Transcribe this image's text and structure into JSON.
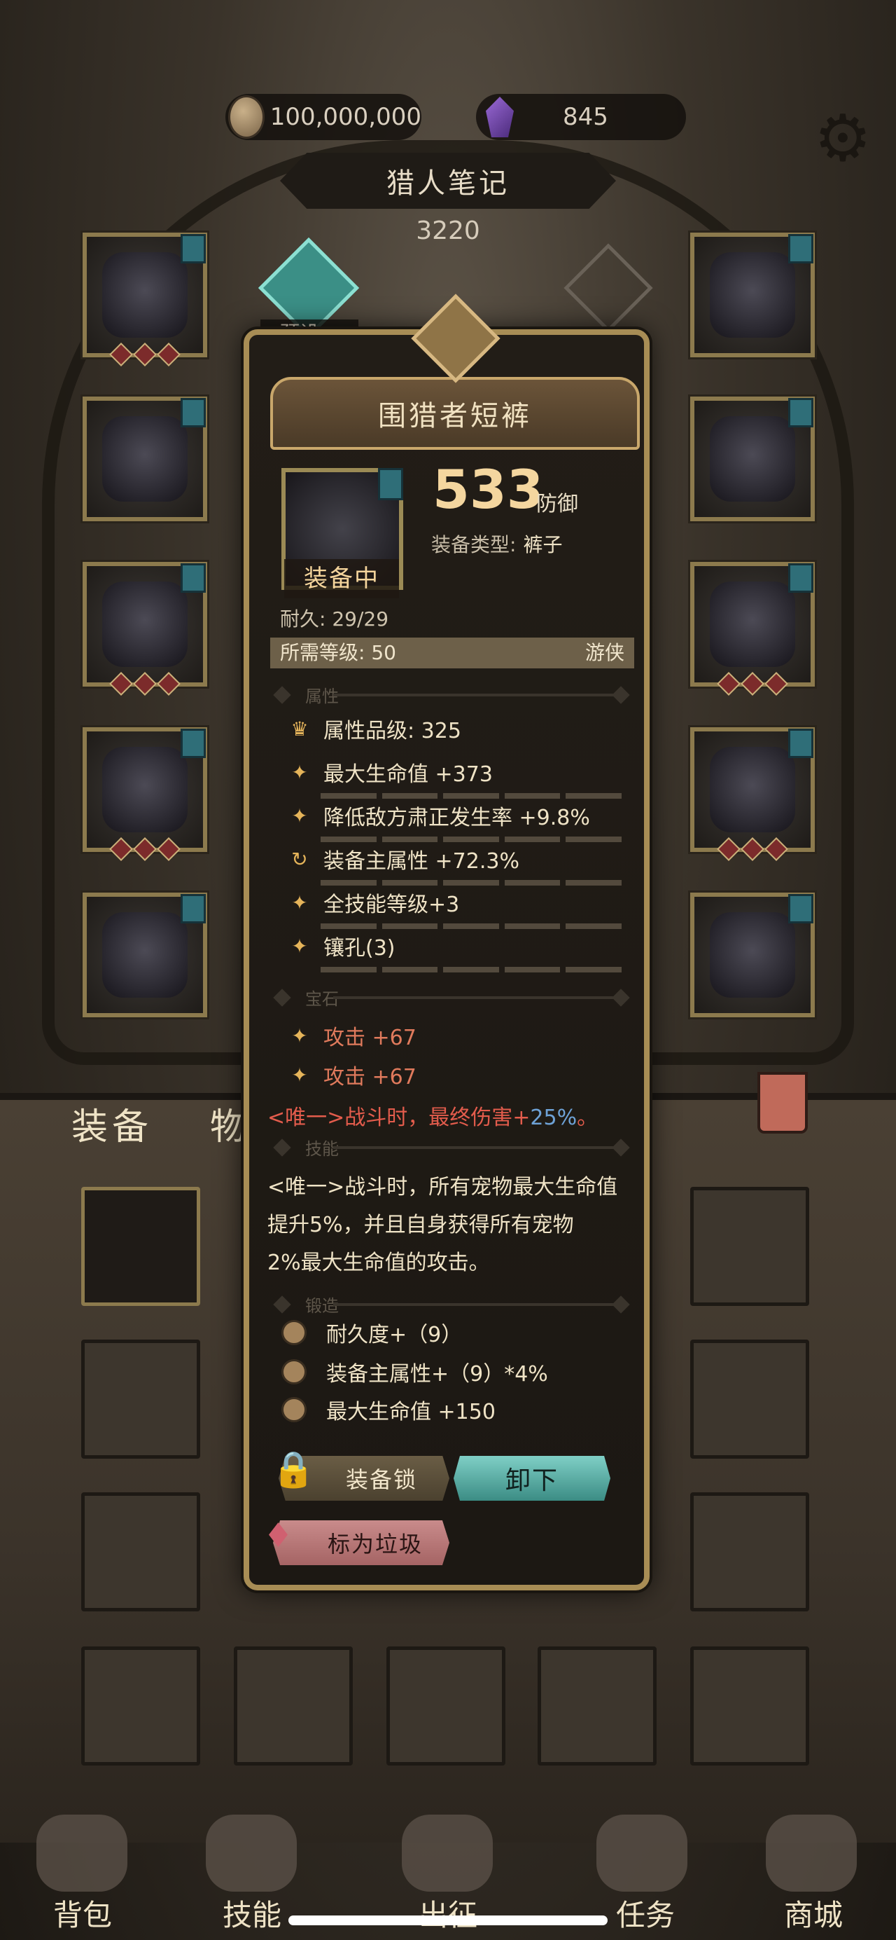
{
  "currency": {
    "gold": "100,000,000",
    "gems": "845"
  },
  "header": {
    "title": "猎人笔记",
    "score": "3220"
  },
  "preset": {
    "label": "预设一"
  },
  "tabs": {
    "equip": "装备",
    "items": "物"
  },
  "nav": {
    "bag": "背包",
    "skills": "技能",
    "expedition": "出征",
    "quests": "任务",
    "shop": "商城"
  },
  "popup": {
    "name": "围猎者短裤",
    "status": "装备中",
    "value": "533",
    "value_unit": "防御",
    "type_label": "装备类型:",
    "type_value": "裤子",
    "durability": "耐久: 29/29",
    "req_level": "所需等级: 50",
    "req_class": "游侠",
    "section_attr": "属性",
    "section_gem": "宝石",
    "section_skill": "技能",
    "section_forge": "锻造",
    "grade": "属性品级: 325",
    "attrs": [
      "最大生命值 +373",
      "降低敌方肃正发生率 +9.8%",
      "装备主属性 +72.3%",
      "全技能等级+3",
      "镶孔(3)"
    ],
    "gems": [
      "攻击 +67",
      "攻击 +67"
    ],
    "unique_prefix": "<唯一>战斗时，最终伤害+",
    "unique_value": "25%",
    "unique_suffix": "。",
    "skill_text": "<唯一>战斗时，所有宠物最大生命值\n提升5%，并且自身获得所有宠物\n2%最大生命值的攻击。",
    "forge": [
      "耐久度+（9）",
      "装备主属性+（9）*4%",
      "最大生命值 +150"
    ],
    "btn_lock": "装备锁",
    "btn_unequip": "卸下",
    "btn_junk": "标为垃圾"
  },
  "colors": {
    "accent": "#f4d69f",
    "teal": "#3b8c84",
    "red": "#e35c4c"
  }
}
